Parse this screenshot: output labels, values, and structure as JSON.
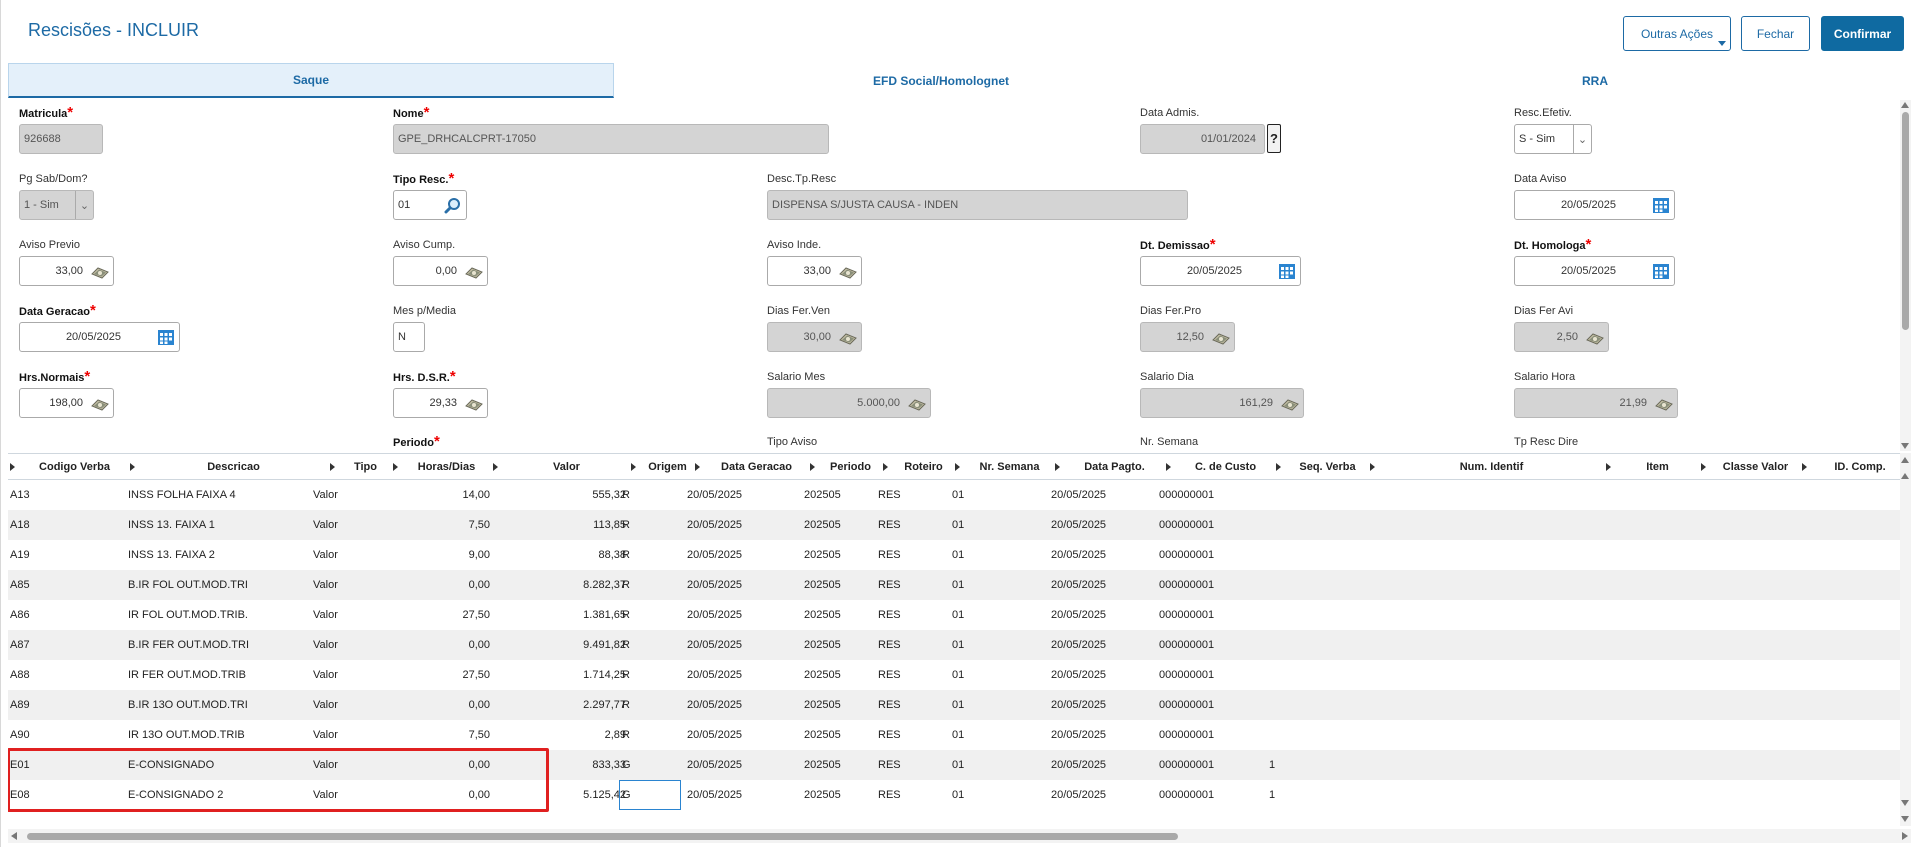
{
  "header": {
    "title": "Rescisões - INCLUIR",
    "other_actions": "Outras Ações",
    "close": "Fechar",
    "confirm": "Confirmar"
  },
  "tabs": [
    {
      "label": "Saque",
      "active": true
    },
    {
      "label": "EFD Social/Homolognet",
      "active": false
    },
    {
      "label": "RRA",
      "active": false
    }
  ],
  "form": {
    "matricula": {
      "label": "Matricula",
      "value": "926688"
    },
    "nome": {
      "label": "Nome",
      "value": "GPE_DRHCALCPRT-17050"
    },
    "data_admis": {
      "label": "Data Admis.",
      "value": "01/01/2024",
      "help": "?"
    },
    "resc_efetiv": {
      "label": "Resc.Efetiv.",
      "value": "S - Sim"
    },
    "pg_sab_dom": {
      "label": "Pg Sab/Dom?",
      "value": "1 - Sim"
    },
    "tipo_resc": {
      "label": "Tipo Resc.",
      "value": "01"
    },
    "desc_tp_resc": {
      "label": "Desc.Tp.Resc",
      "value": "DISPENSA S/JUSTA CAUSA - INDEN"
    },
    "data_aviso": {
      "label": "Data Aviso",
      "value": "20/05/2025"
    },
    "aviso_previo": {
      "label": "Aviso Previo",
      "value": "33,00"
    },
    "aviso_cump": {
      "label": "Aviso Cump.",
      "value": "0,00"
    },
    "aviso_inde": {
      "label": "Aviso Inde.",
      "value": "33,00"
    },
    "dt_demissao": {
      "label": "Dt. Demissao",
      "value": "20/05/2025"
    },
    "dt_homologa": {
      "label": "Dt. Homologa",
      "value": "20/05/2025"
    },
    "data_geracao": {
      "label": "Data Geracao",
      "value": "20/05/2025"
    },
    "mes_p_media": {
      "label": "Mes p/Media",
      "value": "N"
    },
    "dias_fer_ven": {
      "label": "Dias Fer.Ven",
      "value": "30,00"
    },
    "dias_fer_pro": {
      "label": "Dias Fer.Pro",
      "value": "12,50"
    },
    "dias_fer_avi": {
      "label": "Dias Fer Avi",
      "value": "2,50"
    },
    "hrs_normais": {
      "label": "Hrs.Normais",
      "value": "198,00"
    },
    "hrs_dsr": {
      "label": "Hrs. D.S.R.",
      "value": "29,33"
    },
    "salario_mes": {
      "label": "Salario Mes",
      "value": "5.000,00"
    },
    "salario_dia": {
      "label": "Salario Dia",
      "value": "161,29"
    },
    "salario_hora": {
      "label": "Salario Hora",
      "value": "21,99"
    },
    "periodo": {
      "label": "Periodo"
    },
    "tipo_aviso": {
      "label": "Tipo Aviso"
    },
    "nr_semana": {
      "label": "Nr. Semana"
    },
    "tp_resc_dire": {
      "label": "Tp Resc Dire"
    }
  },
  "grid": {
    "columns": [
      "Codigo Verba",
      "Descricao",
      "Tipo",
      "Horas/Dias",
      "Valor",
      "Origem",
      "Data Geracao",
      "Periodo",
      "Roteiro",
      "Nr. Semana",
      "Data Pagto.",
      "C. de Custo",
      "Seq. Verba",
      "Num. Identif",
      "Item",
      "Classe Valor",
      "ID. Comp."
    ],
    "rows": [
      [
        "A13",
        "INSS FOLHA FAIXA 4",
        "Valor",
        "14,00",
        "555,32",
        "R",
        "20/05/2025",
        "202505",
        "RES",
        "01",
        "20/05/2025",
        "000000001",
        ""
      ],
      [
        "A18",
        "INSS 13. FAIXA 1",
        "Valor",
        "7,50",
        "113,85",
        "R",
        "20/05/2025",
        "202505",
        "RES",
        "01",
        "20/05/2025",
        "000000001",
        ""
      ],
      [
        "A19",
        "INSS 13. FAIXA 2",
        "Valor",
        "9,00",
        "88,38",
        "R",
        "20/05/2025",
        "202505",
        "RES",
        "01",
        "20/05/2025",
        "000000001",
        ""
      ],
      [
        "A85",
        "B.IR FOL OUT.MOD.TRI",
        "Valor",
        "0,00",
        "8.282,37",
        "R",
        "20/05/2025",
        "202505",
        "RES",
        "01",
        "20/05/2025",
        "000000001",
        ""
      ],
      [
        "A86",
        "IR FOL OUT.MOD.TRIB.",
        "Valor",
        "27,50",
        "1.381,65",
        "R",
        "20/05/2025",
        "202505",
        "RES",
        "01",
        "20/05/2025",
        "000000001",
        ""
      ],
      [
        "A87",
        "B.IR FER OUT.MOD.TRI",
        "Valor",
        "0,00",
        "9.491,82",
        "R",
        "20/05/2025",
        "202505",
        "RES",
        "01",
        "20/05/2025",
        "000000001",
        ""
      ],
      [
        "A88",
        "IR FER OUT.MOD.TRIB",
        "Valor",
        "27,50",
        "1.714,25",
        "R",
        "20/05/2025",
        "202505",
        "RES",
        "01",
        "20/05/2025",
        "000000001",
        ""
      ],
      [
        "A89",
        "B.IR 13O OUT.MOD.TRI",
        "Valor",
        "0,00",
        "2.297,77",
        "R",
        "20/05/2025",
        "202505",
        "RES",
        "01",
        "20/05/2025",
        "000000001",
        ""
      ],
      [
        "A90",
        "IR 13O OUT.MOD.TRIB",
        "Valor",
        "7,50",
        "2,89",
        "R",
        "20/05/2025",
        "202505",
        "RES",
        "01",
        "20/05/2025",
        "000000001",
        ""
      ],
      [
        "E01",
        "E-CONSIGNADO",
        "Valor",
        "0,00",
        "833,33",
        "G",
        "20/05/2025",
        "202505",
        "RES",
        "01",
        "20/05/2025",
        "000000001",
        "1"
      ],
      [
        "E08",
        "E-CONSIGNADO 2",
        "Valor",
        "0,00",
        "5.125,42",
        "G",
        "20/05/2025",
        "202505",
        "RES",
        "01",
        "20/05/2025",
        "000000001",
        "1"
      ]
    ]
  },
  "icons": {
    "calendar": "calendar-icon",
    "calculator": "calculator-icon",
    "search": "search-icon"
  },
  "colors": {
    "primary": "#0f6aa1",
    "highlight": "#e02020",
    "required": "#e00000"
  }
}
